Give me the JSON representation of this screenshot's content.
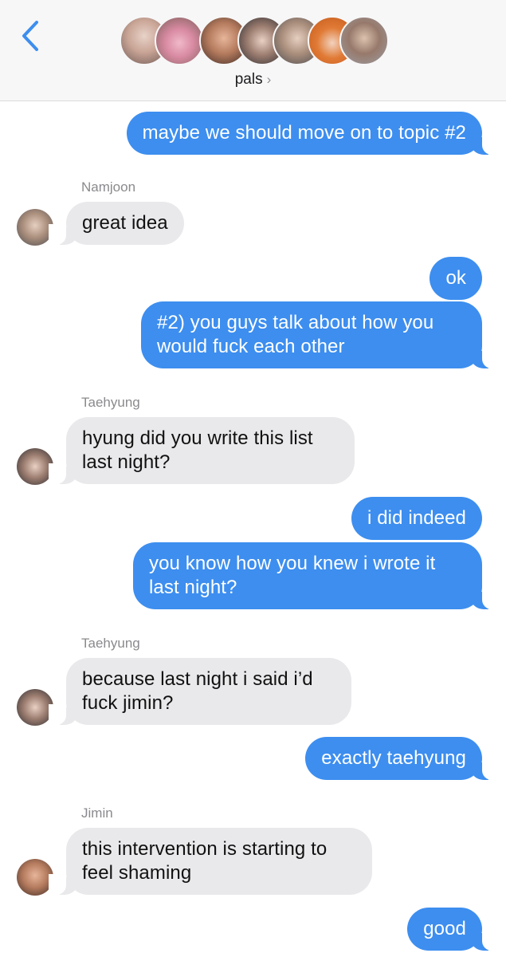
{
  "header": {
    "group_name": "pals",
    "back_icon": "chevron-left-icon",
    "accent": "#3d8eef"
  },
  "messages": [
    {
      "from": "me",
      "text": "maybe we should move on to topic #2"
    },
    {
      "from": "Namjoon",
      "text": "great idea"
    },
    {
      "from": "me",
      "text": "ok"
    },
    {
      "from": "me",
      "text_lines": [
        "#2) you guys talk about how you",
        "would fuck each other"
      ]
    },
    {
      "from": "Taehyung",
      "text_lines": [
        "hyung did you write this list",
        "last night?"
      ]
    },
    {
      "from": "me",
      "text": "i did indeed"
    },
    {
      "from": "me",
      "text_lines": [
        "you know how you knew i wrote it",
        "last night?"
      ]
    },
    {
      "from": "Taehyung",
      "text_lines": [
        "because last night i said i’d",
        "fuck jimin?"
      ]
    },
    {
      "from": "me",
      "text": "exactly taehyung"
    },
    {
      "from": "Jimin",
      "text_lines": [
        "this intervention is starting to",
        "feel shaming"
      ]
    },
    {
      "from": "me",
      "text": "good"
    }
  ],
  "senders": {
    "namjoon": "Namjoon",
    "taehyung": "Taehyung",
    "jimin": "Jimin"
  }
}
